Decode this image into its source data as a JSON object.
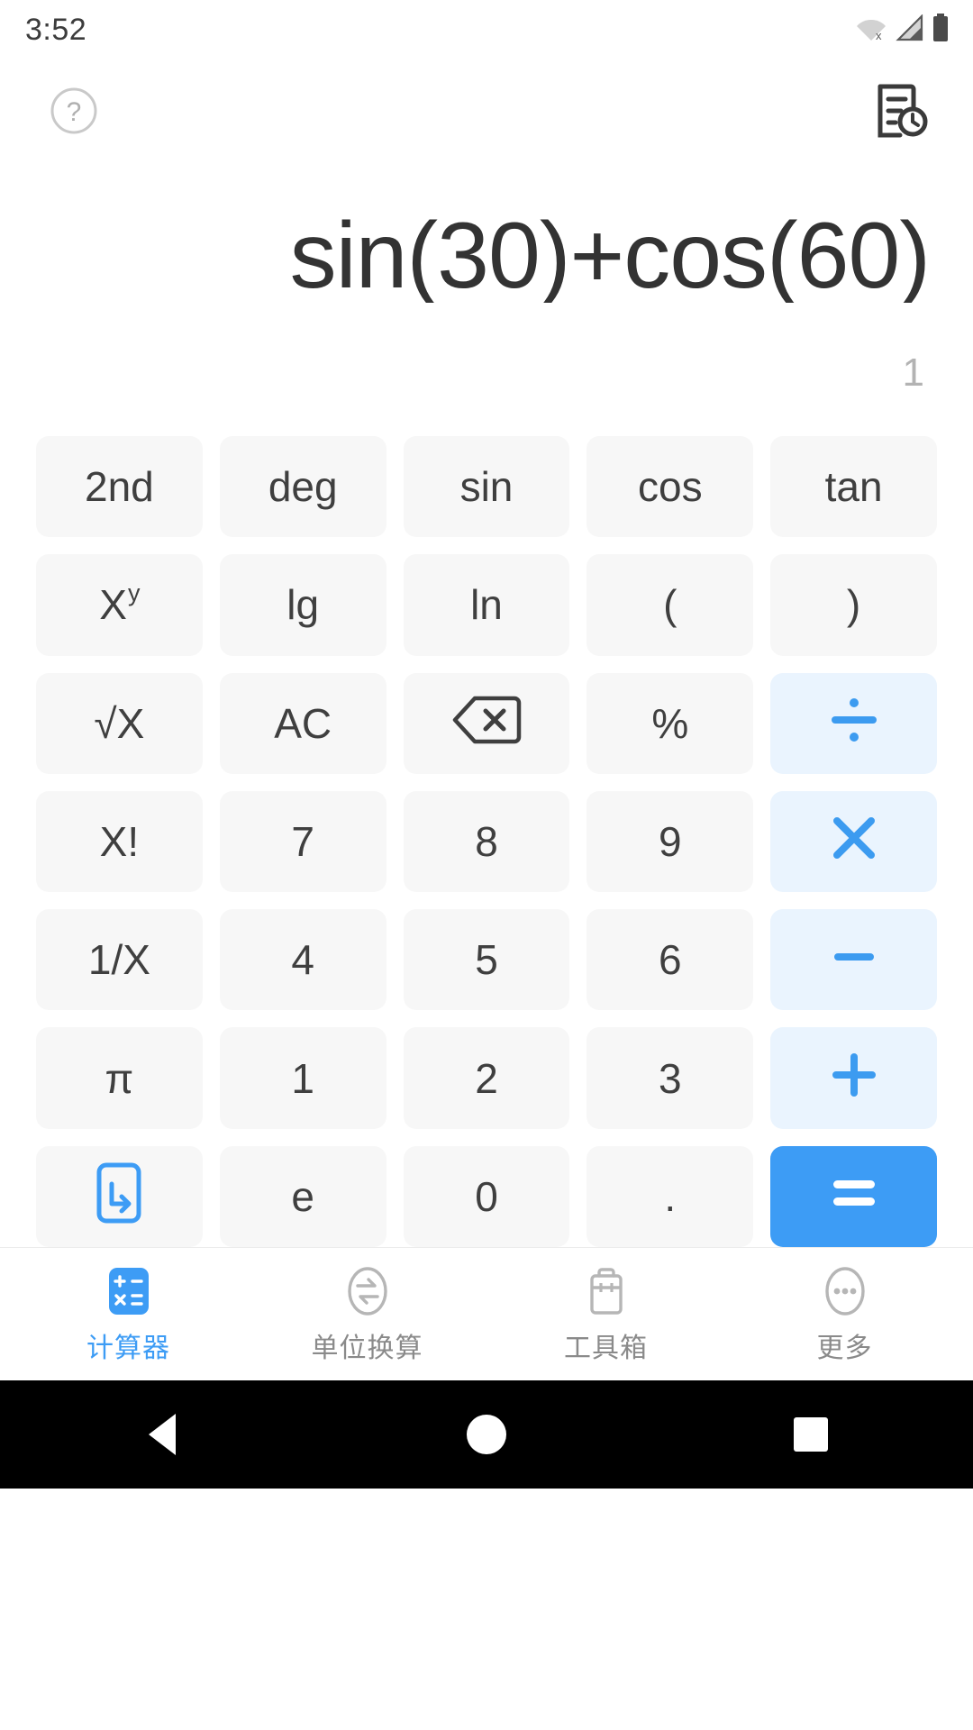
{
  "status_bar": {
    "time": "3:52",
    "icons": [
      "wifi-off-icon",
      "signal-icon",
      "battery-icon"
    ]
  },
  "action_bar": {
    "help_icon": "help-circle-icon",
    "history_icon": "history-document-icon"
  },
  "display": {
    "expression": "sin(30)+cos(60)",
    "result": "1"
  },
  "colors": {
    "accent": "#3d9cf5",
    "operator_bg": "#eaf4fe",
    "key_bg": "#f7f7f7",
    "key_text": "#3f3f3f",
    "expression_text": "#333333",
    "result_text": "#b3b3b3"
  },
  "keypad": {
    "rows": [
      [
        {
          "label": "2nd",
          "name": "key-2nd",
          "type": "fn"
        },
        {
          "label": "deg",
          "name": "key-deg",
          "type": "fn"
        },
        {
          "label": "sin",
          "name": "key-sin",
          "type": "fn"
        },
        {
          "label": "cos",
          "name": "key-cos",
          "type": "fn"
        },
        {
          "label": "tan",
          "name": "key-tan",
          "type": "fn"
        }
      ],
      [
        {
          "label": "X",
          "sup": "y",
          "name": "key-power",
          "type": "fn"
        },
        {
          "label": "lg",
          "name": "key-lg",
          "type": "fn"
        },
        {
          "label": "ln",
          "name": "key-ln",
          "type": "fn"
        },
        {
          "label": "(",
          "name": "key-open-paren",
          "type": "fn"
        },
        {
          "label": ")",
          "name": "key-close-paren",
          "type": "fn"
        }
      ],
      [
        {
          "label": "√X",
          "name": "key-sqrt",
          "type": "fn"
        },
        {
          "label": "AC",
          "name": "key-all-clear",
          "type": "fn"
        },
        {
          "label": "",
          "name": "key-backspace",
          "type": "icon",
          "icon": "backspace-icon"
        },
        {
          "label": "%",
          "name": "key-percent",
          "type": "fn"
        },
        {
          "label": "÷",
          "name": "key-divide",
          "type": "op",
          "icon": "divide-icon"
        }
      ],
      [
        {
          "label": "X!",
          "name": "key-factorial",
          "type": "fn"
        },
        {
          "label": "7",
          "name": "key-7",
          "type": "num"
        },
        {
          "label": "8",
          "name": "key-8",
          "type": "num"
        },
        {
          "label": "9",
          "name": "key-9",
          "type": "num"
        },
        {
          "label": "×",
          "name": "key-multiply",
          "type": "op",
          "icon": "multiply-icon"
        }
      ],
      [
        {
          "label": "1/X",
          "name": "key-reciprocal",
          "type": "fn"
        },
        {
          "label": "4",
          "name": "key-4",
          "type": "num"
        },
        {
          "label": "5",
          "name": "key-5",
          "type": "num"
        },
        {
          "label": "6",
          "name": "key-6",
          "type": "num"
        },
        {
          "label": "−",
          "name": "key-minus",
          "type": "op",
          "icon": "minus-icon"
        }
      ],
      [
        {
          "label": "π",
          "name": "key-pi",
          "type": "fn"
        },
        {
          "label": "1",
          "name": "key-1",
          "type": "num"
        },
        {
          "label": "2",
          "name": "key-2",
          "type": "num"
        },
        {
          "label": "3",
          "name": "key-3",
          "type": "num"
        },
        {
          "label": "+",
          "name": "key-plus",
          "type": "op",
          "icon": "plus-icon"
        }
      ],
      [
        {
          "label": "",
          "name": "key-collapse-keypad",
          "type": "icon",
          "icon": "arrow-down-right-box-icon"
        },
        {
          "label": "e",
          "name": "key-e",
          "type": "fn"
        },
        {
          "label": "0",
          "name": "key-0",
          "type": "num"
        },
        {
          "label": ".",
          "name": "key-decimal",
          "type": "num"
        },
        {
          "label": "=",
          "name": "key-equals",
          "type": "equals",
          "icon": "equals-icon"
        }
      ]
    ]
  },
  "tabbar": {
    "items": [
      {
        "label": "计算器",
        "name": "tab-calculator",
        "icon": "calculator-icon",
        "active": true
      },
      {
        "label": "单位换算",
        "name": "tab-unit-conversion",
        "icon": "convert-icon",
        "active": false
      },
      {
        "label": "工具箱",
        "name": "tab-toolbox",
        "icon": "toolbox-icon",
        "active": false
      },
      {
        "label": "更多",
        "name": "tab-more",
        "icon": "more-dots-icon",
        "active": false
      }
    ]
  },
  "android_nav": {
    "back": "back-icon",
    "home": "home-icon",
    "recents": "recents-icon"
  }
}
